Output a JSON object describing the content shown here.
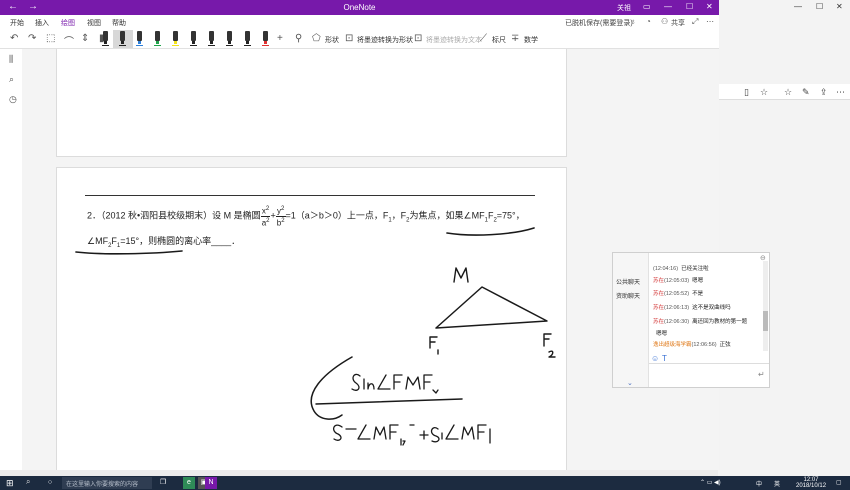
{
  "app": {
    "title": "OneNote",
    "user": "关祖",
    "back_icon": "back-arrow-icon",
    "forward_icon": "forward-arrow-icon"
  },
  "menubar": {
    "items": [
      "开始",
      "插入",
      "绘图",
      "视图",
      "帮助"
    ],
    "active": "绘图",
    "sync_status": "已脱机保存(需要登录)",
    "share_label": "共享"
  },
  "ribbon": {
    "shape_label": "形状",
    "ink_to_shape_label": "将墨迹转换为形状",
    "ink_to_text_label": "将墨迹转换为文本",
    "ruler_label": "标尺",
    "math_label": "数学",
    "pen_colors": [
      "#222222",
      "#222222",
      "#2f7fd8",
      "#1fa34a",
      "#f2e21a",
      "#222222",
      "#222222",
      "#222222",
      "#222222",
      "#e03030"
    ]
  },
  "question": {
    "line1_a": "2．（2012 秋•泗阳县校级期末）设 M 是椭圆",
    "frac1_num": "x",
    "frac1_den": "a",
    "plus": "+",
    "frac2_num": "y",
    "frac2_den": "b",
    "line1_b": "=1（a＞b＞0）上一点，F",
    "line1_c": "，F",
    "line1_d": "为焦点，如果∠MF",
    "line1_e": "F",
    "line1_f": "=75°，",
    "line2_a": "∠MF",
    "line2_b": "F",
    "line2_c": "=15°，则椭圆的离心率",
    "line2_blank": "____",
    "line2_end": "．",
    "sub1": "1",
    "sub2": "2",
    "sup2": "2"
  },
  "chat": {
    "tabs": [
      "公共聊天",
      "资助聊天"
    ],
    "messages": [
      {
        "who": "",
        "time": "(12:04:16)",
        "text": "已经关注啦"
      },
      {
        "who": "苏在",
        "time": "(12:05:03)",
        "text": "嗯嗯"
      },
      {
        "who": "苏在",
        "time": "(12:05:52)",
        "text": "不是"
      },
      {
        "who": "苏在",
        "time": "(12:06:13)",
        "text": "这不是双曲线吗"
      },
      {
        "who": "苏在",
        "time": "(12:06:30)",
        "text": "离还回为教材的第一题"
      },
      {
        "who": "",
        "time": "",
        "text": "嗯嗯"
      },
      {
        "who": "逸出超级海学霸",
        "time": "(12:06:56)",
        "text": "正弦"
      }
    ]
  },
  "taskbar": {
    "search_placeholder": "在这里输入你要搜索的内容",
    "ime": "中",
    "lang": "英",
    "time": "12:07",
    "date": "2018/10/12"
  }
}
